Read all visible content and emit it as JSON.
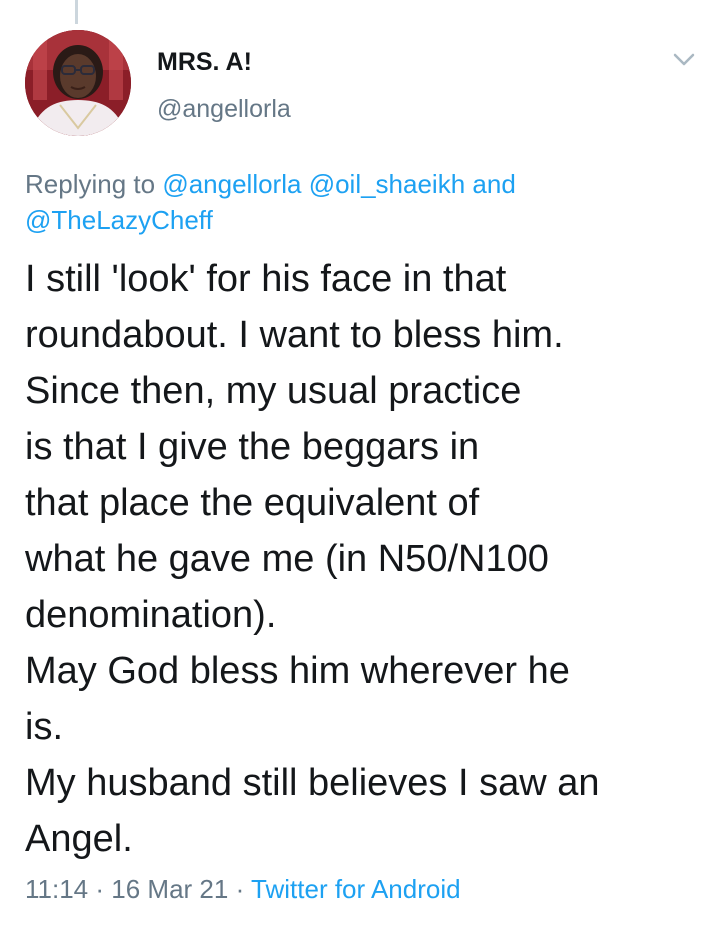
{
  "tweet": {
    "author_name": "MRS. A!",
    "author_handle": "@angellorla",
    "reply": {
      "prefix": "Replying to",
      "mention1": "@angellorla",
      "mention2": "@oil_shaeikh",
      "conjunction": "and",
      "mention3": "@TheLazyCheff"
    },
    "text_lines": [
      "I still 'look' for his face in that",
      "roundabout. I want to bless him.",
      "Since then, my usual practice",
      "is that I give the beggars in",
      "that place the equivalent of",
      "what he gave me (in N50/N100",
      "denomination).",
      "May God bless him wherever he",
      "is.",
      "My husband still believes I saw an",
      "Angel."
    ],
    "time": "11:14",
    "separator": "·",
    "date": "16 Mar 21",
    "source": "Twitter for Android"
  },
  "colors": {
    "text": "#14171a",
    "secondary": "#657786",
    "link": "#1da1f2"
  },
  "icons": {
    "menu": "chevron-down-icon"
  }
}
